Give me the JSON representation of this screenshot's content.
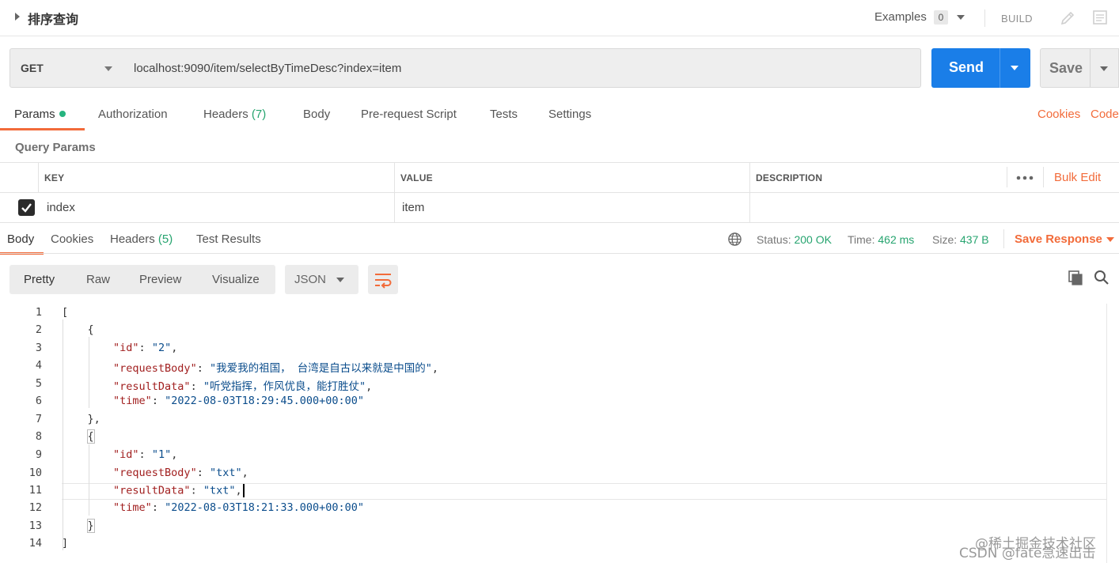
{
  "topbar": {
    "title": "排序查询",
    "examples_label": "Examples",
    "examples_count": "0",
    "build_label": "BUILD"
  },
  "request": {
    "method": "GET",
    "url": "localhost:9090/item/selectByTimeDesc?index=item",
    "send_label": "Send",
    "save_label": "Save"
  },
  "request_tabs": {
    "params": "Params",
    "authorization": "Authorization",
    "headers": "Headers",
    "headers_count": "(7)",
    "body": "Body",
    "prerequest": "Pre-request Script",
    "tests": "Tests",
    "settings": "Settings",
    "cookies": "Cookies",
    "code": "Code"
  },
  "query_params": {
    "label": "Query Params",
    "columns": [
      "KEY",
      "VALUE",
      "DESCRIPTION"
    ],
    "bulk_edit": "Bulk Edit",
    "rows": [
      {
        "key": "index",
        "value": "item",
        "description": ""
      }
    ]
  },
  "response": {
    "tabs": {
      "body": "Body",
      "cookies": "Cookies",
      "headers": "Headers",
      "headers_count": "(5)",
      "test_results": "Test Results"
    },
    "status_label": "Status:",
    "status_value": "200 OK",
    "time_label": "Time:",
    "time_value": "462 ms",
    "size_label": "Size:",
    "size_value": "437 B",
    "save_response": "Save Response",
    "views": [
      "Pretty",
      "Raw",
      "Preview",
      "Visualize"
    ],
    "format": "JSON"
  },
  "code": {
    "line_numbers": [
      "1",
      "2",
      "3",
      "4",
      "5",
      "6",
      "7",
      "8",
      "9",
      "10",
      "11",
      "12",
      "13",
      "14"
    ],
    "records": [
      {
        "id": "2",
        "requestBody": "我爱我的祖国， 台湾是自古以来就是中国的",
        "resultData": "听党指挥，作风优良，能打胜仗",
        "time": "2022-08-03T18:29:45.000+00:00"
      },
      {
        "id": "1",
        "requestBody": "txt",
        "resultData": "txt",
        "time": "2022-08-03T18:21:33.000+00:00"
      }
    ]
  },
  "watermark": {
    "line1": "@稀土掘金技术社区",
    "line2": "CSDN @fate急速出击"
  },
  "colors": {
    "accent_orange": "#f26b3a",
    "send_blue": "#1a7ee8",
    "success_green": "#26a46f",
    "json_key": "#a11f1f",
    "json_string": "#0b4d8c"
  }
}
